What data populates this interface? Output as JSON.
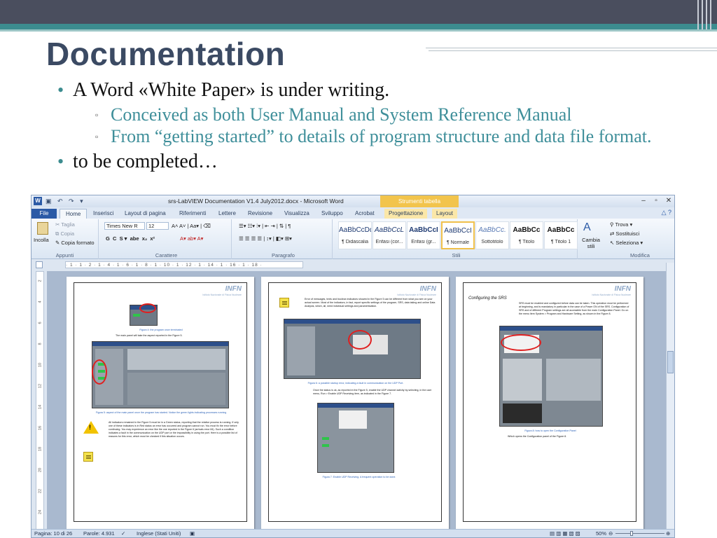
{
  "slide": {
    "title": "Documentation",
    "bullets": [
      {
        "text": "A Word «White Paper» is under writing.",
        "sub": [
          "Conceived as both User Manual and System Reference Manual",
          "From “getting started” to details of program structure and data file format."
        ]
      },
      {
        "text": "to be completed…",
        "sub": []
      }
    ]
  },
  "word": {
    "logo": "W",
    "window_title": "srs-LabVIEW Documentation V1.4 July2012.docx - Microsoft Word",
    "context_tab_group": "Strumenti tabella",
    "tabs": [
      "File",
      "Home",
      "Inserisci",
      "Layout di pagina",
      "Riferimenti",
      "Lettere",
      "Revisione",
      "Visualizza",
      "Sviluppo",
      "Acrobat",
      "Progettazione",
      "Layout"
    ],
    "ribbon": {
      "clipboard": {
        "paste": "Incolla",
        "cut": "Taglia",
        "copy": "Copia",
        "format_painter": "Copia formato",
        "label": "Appunti"
      },
      "font": {
        "name": "Times New R",
        "size": "12",
        "label": "Carattere"
      },
      "paragraph": {
        "label": "Paragrafo"
      },
      "styles": {
        "label": "Stili",
        "tiles": [
          {
            "sample": "AaBbCcDdI",
            "name": "¶ Didascalia"
          },
          {
            "sample": "AaBbCcL",
            "name": "Enfasi (cor..."
          },
          {
            "sample": "AaBbCcI",
            "name": "Enfasi (gr..."
          },
          {
            "sample": "AaBbCcI",
            "name": "¶ Normale"
          },
          {
            "sample": "AaBbCc.",
            "name": "Sottotitolo"
          },
          {
            "sample": "AaBbCc",
            "name": "¶ Titolo"
          },
          {
            "sample": "AaBbCc",
            "name": "¶ Titolo 1"
          }
        ],
        "change": "Cambia stili"
      },
      "editing": {
        "find": "Trova",
        "replace": "Sostituisci",
        "select": "Seleziona",
        "label": "Modifica"
      }
    },
    "ruler_text": "· 1 · 1 · 2 · 1 · 4 · 1 · 6 · 1 · 8 · 1 · 10 · 1 · 12 · 1 · 14 · 1 · 16 · 1 · 18 ·",
    "vruler_marks": [
      "2",
      "4",
      "6",
      "8",
      "10",
      "12",
      "14",
      "16",
      "18",
      "20",
      "22",
      "24"
    ],
    "pages": {
      "logo": "INFN",
      "logo_sub": "Istituto Nazionale di Fisica Nucleare",
      "p1": {
        "cap1": "Figura 4: the program once terminated",
        "line1": "The main panel will take the aspect reported in the Figure 5.",
        "cap2": "Figura 5: aspect of the main panel once the program has started. Notice the green lights indicating processes running",
        "body": "All indicators remained in the Figure 5 must be in a Green status, reporting that the relative process is running. If only one of these indicators is in Red status an error has occurred and program cannot run. You must fix the error before continuing. You may experience an error like the one reported in the Figure 6 (arrivals error 84). Such a condition indicates a fault in the communication on the UDP port or the impossibility in using the port. Here is a possible list of reasons for this error, which must be checked if this situation occurs."
      },
      "p2": {
        "body": "Error of messages, texts and boolean indicators showed in the Figure 5 can be different from what you see on your actual screen. Most of the indicators, in fact, report specific settings of the program, SRS, data taking and online Data Analysis, which, all, need individual settings and parametrization.",
        "cap1": "Figura 6: a possible startup error, indicating a fault in communication on the UDP Port.",
        "body2": "Once the status is ok, as reported in the Figure 5, enable the UDP channel activity by selecting, in the user menu, Run > Enable UDP Receiving item, as indicated in the Figure 7.",
        "cap2": "Figura 7: Enable UDP Receiving. A frequent operation to be done."
      },
      "p3": {
        "heading": "Configuring the SRS",
        "body": "SRS must be enabled and configured before data can be taken. This operation must be performed at beginning, and is mandatory in particular in the case of a Power ON of the SRS. Configuration of SRS and of different Program settings are all accessible from the main Configuration Panel. Go on the menu item System > Program and Hardware Setting, as shown in the Figure 8.",
        "cap": "Figura 8: how to open the Configuration Panel",
        "line": "Which opens the Configuration panel of the Figure 8."
      }
    },
    "status": {
      "page": "Pagina: 10 di 26",
      "words": "Parole: 4.931",
      "language": "Inglese (Stati Uniti)",
      "zoom": "50%"
    }
  }
}
